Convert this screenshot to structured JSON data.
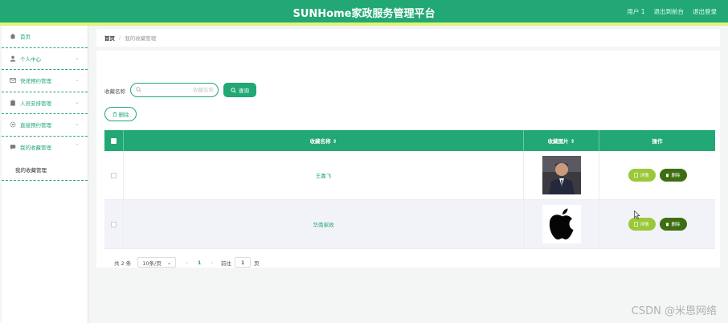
{
  "header": {
    "title": "SUNHome家政服务管理平台",
    "links": [
      "用户 1",
      "退出到前台",
      "退出登录"
    ]
  },
  "sidebar": {
    "items": [
      {
        "label": "首页",
        "icon": "home-icon",
        "expandable": false
      },
      {
        "label": "个人中心",
        "icon": "user-icon",
        "expandable": true
      },
      {
        "label": "快递预约管理",
        "icon": "mail-icon",
        "expandable": true
      },
      {
        "label": "人员安排管理",
        "icon": "clipboard-icon",
        "expandable": true
      },
      {
        "label": "直接预约管理",
        "icon": "settings-icon",
        "expandable": true
      },
      {
        "label": "我的收藏管理",
        "icon": "message-icon",
        "expandable": true,
        "expanded": true
      }
    ],
    "subitems": [
      "我的收藏管理"
    ]
  },
  "breadcrumb": {
    "home": "首页",
    "current": "我的收藏管理"
  },
  "search": {
    "label": "收藏名称",
    "placeholder": "收藏名称",
    "value": "",
    "query_button": "查询",
    "delete_button": "删除"
  },
  "table": {
    "columns": [
      "收藏名称 ⇕",
      "收藏图片 ⇕",
      "操作"
    ],
    "rows": [
      {
        "name": "王嘉飞",
        "image": "man-portrait-photo"
      },
      {
        "name": "华南家政",
        "image": "apple-logo"
      }
    ],
    "detail_label": "详情",
    "delete_label": "删除"
  },
  "pagination": {
    "total": "共 2 条",
    "page_size": "10条/页",
    "current_page": "1",
    "goto_label": "前往",
    "goto_value": "1",
    "goto_unit": "页"
  },
  "watermark": "CSDN @米恩网络",
  "colors": {
    "primary": "#21a874",
    "accent_stripe": "#dff57a",
    "detail_button": "#9ac83a",
    "delete_button": "#3e6e12"
  }
}
